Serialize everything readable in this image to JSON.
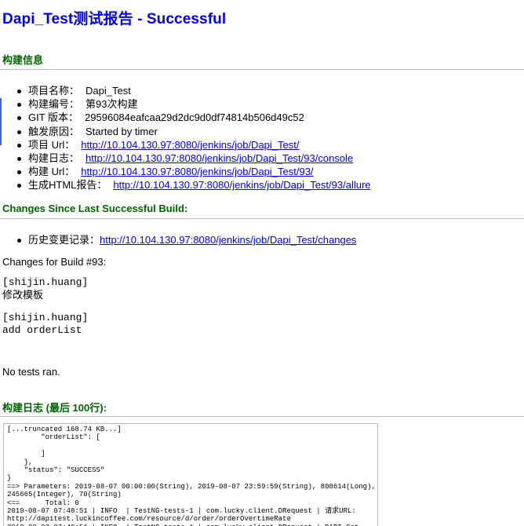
{
  "report": {
    "title": "Dapi_Test测试报告 - Successful"
  },
  "build_info": {
    "heading": "构建信息",
    "items": [
      {
        "label": "项目名称：",
        "value": "Dapi_Test"
      },
      {
        "label": "构建编号：",
        "value": "第93次构建"
      },
      {
        "label": "GIT 版本：",
        "value": "29596084eafcaa29d2dc9d0df74814b506d49c52"
      },
      {
        "label": "触发原因：",
        "value": "Started by timer"
      }
    ],
    "links": [
      {
        "label": "项目 Url：",
        "url": "http://10.104.130.97:8080/jenkins/job/Dapi_Test/"
      },
      {
        "label": "构建日志：",
        "url": "http://10.104.130.97:8080/jenkins/job/Dapi_Test/93/console"
      },
      {
        "label": "构建 Url：",
        "url": "http://10.104.130.97:8080/jenkins/job/Dapi_Test/93/"
      },
      {
        "label": "生成HTML报告：",
        "url": "http://10.104.130.97:8080/jenkins/job/Dapi_Test/93/allure"
      }
    ]
  },
  "changes": {
    "heading": "Changes Since Last Successful Build:",
    "history_label": "历史变更记录：",
    "history_url": "http://10.104.130.97:8080/jenkins/job/Dapi_Test/changes",
    "build_changes_title": "Changes for Build #93:",
    "entries": [
      {
        "author": "[shijin.huang]",
        "message": "修改模板"
      },
      {
        "author": "[shijin.huang]",
        "message": "add orderList"
      }
    ]
  },
  "tests": {
    "status": "No tests ran."
  },
  "log": {
    "heading": "构建日志 (最后 100行):",
    "text": "[...truncated 168.74 KB...]\n        \"orderList\": [\n\n        ]\n    },\n    \"status\": \"SUCCESS\"\n}\n==> Parameters: 2019-08-07 00:00:00(String), 2019-08-07 23:59:59(String), 808614(Long),\n245665(Integer), 70(String)\n<==      Total: 0\n2019-08-07 07:48:51 | INFO  | TestNG-tests-1 | com.lucky.client.DRequest | 请求URL:\nhttp://dapitest.luckincoffee.com/resource/d/order/orderOvertimeRate\n2019-08-07 07:48:51 | INFO  | TestNG-tests-1 | com.lucky.client.DRequest | DAPI Get"
  }
}
